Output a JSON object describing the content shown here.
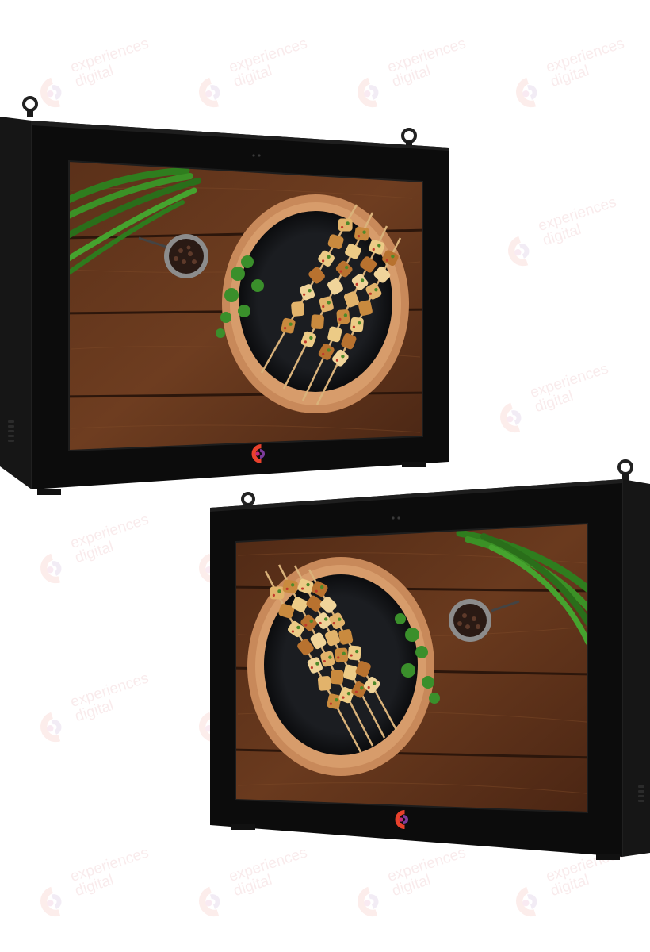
{
  "watermark": {
    "brand_text": "experiences\ndigital",
    "logo_icon": "experiences-digital-logo-icon",
    "colors": {
      "red": "#e8412c",
      "purple": "#7c3b9a",
      "magenta": "#c4287a"
    }
  },
  "displays": [
    {
      "name": "Outdoor LCD display - front-left angle",
      "screen_content": "Grilled chicken skewers on wooden board",
      "bezel_color": "#0c0c0c",
      "badge_icon": "experiences-digital-logo-icon"
    },
    {
      "name": "Outdoor LCD display - front-right angle",
      "screen_content": "Grilled chicken skewers on wooden board",
      "bezel_color": "#0c0c0c",
      "badge_icon": "experiences-digital-logo-icon"
    }
  ]
}
